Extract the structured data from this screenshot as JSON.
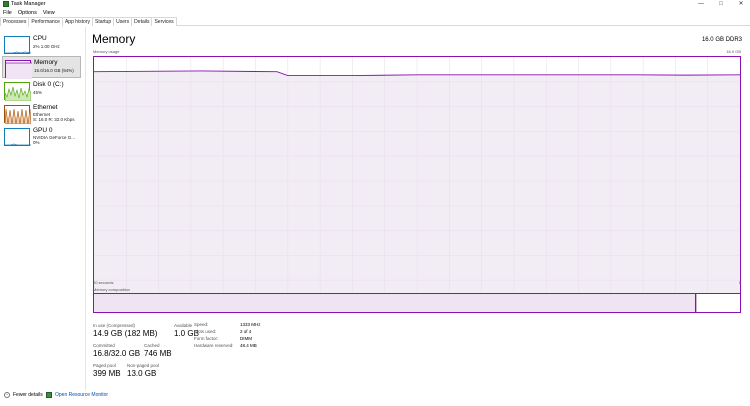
{
  "window": {
    "title": "Task Manager",
    "minimize": "—",
    "maximize": "□",
    "close": "✕"
  },
  "menu": [
    "File",
    "Options",
    "View"
  ],
  "tabs": [
    "Processes",
    "Performance",
    "App history",
    "Startup",
    "Users",
    "Details",
    "Services"
  ],
  "active_tab": "Performance",
  "sidebar": [
    {
      "name": "CPU",
      "sub1": "2% 1.00 GHz",
      "sub2": ""
    },
    {
      "name": "Memory",
      "sub1": "15.0/16.0 GB (94%)",
      "sub2": ""
    },
    {
      "name": "Disk 0 (C:)",
      "sub1": "45%",
      "sub2": ""
    },
    {
      "name": "Ethernet",
      "sub1": "Ethernet",
      "sub2": "S: 16.0  R: 32.0 Kbps"
    },
    {
      "name": "GPU 0",
      "sub1": "NVIDIA GeForce G...",
      "sub2": "0%"
    }
  ],
  "main": {
    "title": "Memory",
    "capacity": "16.0 GB DDR3",
    "graph_label": "Memory usage",
    "graph_max": "16.0 GB",
    "time_left": "60 seconds",
    "time_right": "0",
    "composition_label": "Memory composition"
  },
  "chart_data": {
    "type": "area",
    "title": "Memory usage",
    "ylim": [
      0,
      16
    ],
    "unit": "GB",
    "x_label_left": "60 seconds",
    "x_label_right": "0",
    "x": [
      60,
      50,
      43,
      42,
      36,
      30,
      25,
      20,
      15,
      10,
      5,
      0
    ],
    "values": [
      15.05,
      15.1,
      15.05,
      14.8,
      14.8,
      14.85,
      14.85,
      14.85,
      14.85,
      14.85,
      14.83,
      14.85
    ],
    "grid": true,
    "color": "#8b12ae"
  },
  "composition": {
    "in_use_fraction": 0.93,
    "modified_fraction": 0.002,
    "standby_fraction": 0.045
  },
  "stats": {
    "in_use_label": "In use (Compressed)",
    "in_use_value": "14.9 GB (182 MB)",
    "available_label": "Available",
    "available_value": "1.0 GB",
    "committed_label": "Committed",
    "committed_value": "16.8/32.0 GB",
    "cached_label": "Cached",
    "cached_value": "746 MB",
    "paged_label": "Paged pool",
    "paged_value": "399 MB",
    "nonpaged_label": "Non-paged pool",
    "nonpaged_value": "13.0 GB"
  },
  "properties": {
    "speed_label": "Speed:",
    "speed_value": "1333 MHz",
    "slots_label": "Slots used:",
    "slots_value": "2 of 4",
    "form_label": "Form factor:",
    "form_value": "DIMM",
    "reserved_label": "Hardware reserved:",
    "reserved_value": "48.4 MB"
  },
  "footer": {
    "fewer_details": "Fewer details",
    "resource_monitor": "Open Resource Monitor"
  },
  "colors": {
    "memory": "#8b12ae",
    "cpu": "#117dbb",
    "disk": "#4da60c",
    "ethernet": "#a74f01",
    "gpu": "#117dbb"
  }
}
